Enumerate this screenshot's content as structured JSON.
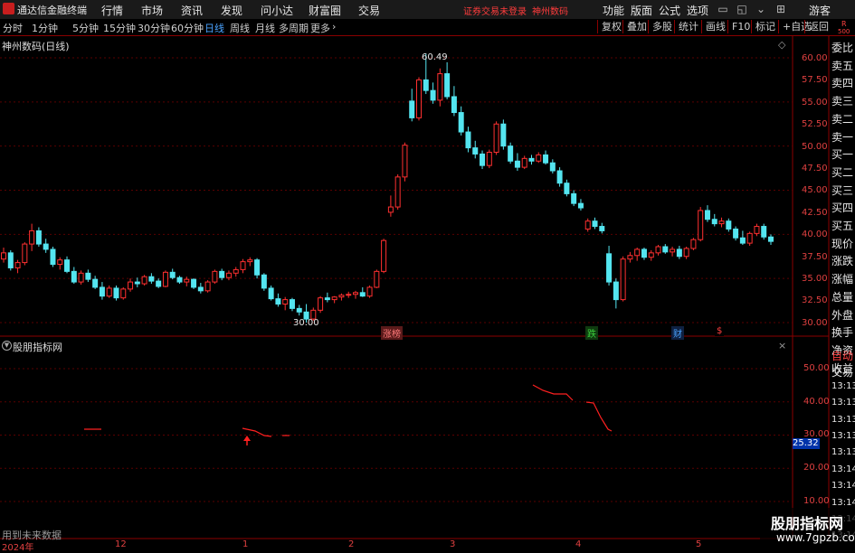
{
  "app": {
    "title": "通达信金融终端",
    "menu": [
      "行情",
      "市场",
      "资讯",
      "发现",
      "问小达",
      "财富圈",
      "交易"
    ],
    "login_warning": "证券交易未登录",
    "stock_label": "神州数码",
    "right_menu": [
      "功能",
      "版面",
      "公式",
      "选项"
    ],
    "user": "游客"
  },
  "period_bar": {
    "periods": [
      "分时",
      "1分钟",
      "5分钟",
      "15分钟",
      "30分钟",
      "60分钟",
      "日线",
      "周线",
      "月线",
      "多周期",
      "更多"
    ],
    "active": "日线",
    "tools": [
      "复权",
      "叠加",
      "多股",
      "统计",
      "画线",
      "F10",
      "标记",
      "+自选",
      "返回"
    ]
  },
  "main_chart": {
    "title": "神州数码(日线)",
    "y_ticks": [
      "60.00",
      "57.50",
      "55.00",
      "52.50",
      "50.00",
      "47.50",
      "45.00",
      "42.50",
      "40.00",
      "37.50",
      "35.00",
      "32.50",
      "30.00"
    ],
    "high_label": "60.49",
    "low_label": "30.00",
    "events": [
      {
        "text": "涨榜",
        "color": "#ff7a7a",
        "bg": "#5a1a1a"
      },
      {
        "text": "跌",
        "color": "#3ccf3c",
        "bg": "#0f3a0f"
      },
      {
        "text": "财",
        "color": "#4aa3ff",
        "bg": "#0f2040"
      },
      {
        "text": "$",
        "color": "#ff4040",
        "bg": "#000000"
      }
    ]
  },
  "indicator": {
    "title": "股朋指标网",
    "y_ticks": [
      "50.00",
      "40.00",
      "30.00",
      "20.00",
      "10.00"
    ],
    "current_value": "25.32",
    "no_data_text": "用到未来数据"
  },
  "x_axis": {
    "labels": [
      "2024年",
      "12",
      "1",
      "2",
      "3",
      "4",
      "5"
    ]
  },
  "right_panel": {
    "rows": [
      "委比",
      "卖五",
      "卖四",
      "卖三",
      "卖二",
      "卖一",
      "买一",
      "买二",
      "买三",
      "买四",
      "买五",
      "现价",
      "涨跌",
      "涨幅",
      "总量",
      "外盘",
      "换手",
      "净资",
      "收益"
    ],
    "bottom_rows": [
      "自动",
      "交易",
      "13:13",
      "13:13",
      "13:13",
      "13:13",
      "13:13",
      "13:14",
      "13:14",
      "13:14",
      "13:14",
      "13:14"
    ],
    "r_label": "R",
    "r_sub": "500"
  },
  "watermark": {
    "title": "股朋指标网",
    "url": "www.7gpzb.com"
  },
  "colors": {
    "up": "#ff3030",
    "down": "#54e5f0",
    "line": "#ff2020",
    "grid": "#8b0000"
  },
  "chart_data": {
    "type": "candlestick",
    "ylim": [
      29.0,
      61.0
    ],
    "high": 60.49,
    "low": 30.0,
    "candles": [
      [
        37.2,
        38.5,
        36.8,
        37.9
      ],
      [
        37.9,
        38.2,
        35.9,
        36.2
      ],
      [
        36.2,
        37.1,
        35.6,
        36.8
      ],
      [
        36.8,
        39.1,
        36.5,
        38.9
      ],
      [
        38.9,
        41.2,
        38.1,
        40.4
      ],
      [
        40.4,
        40.8,
        38.6,
        38.9
      ],
      [
        38.9,
        39.5,
        37.9,
        38.3
      ],
      [
        38.3,
        38.6,
        36.3,
        36.6
      ],
      [
        36.6,
        37.4,
        36.0,
        37.1
      ],
      [
        37.1,
        37.5,
        35.6,
        35.8
      ],
      [
        35.8,
        36.3,
        34.4,
        34.6
      ],
      [
        34.6,
        35.9,
        34.3,
        35.6
      ],
      [
        35.6,
        36.0,
        34.6,
        34.9
      ],
      [
        34.9,
        35.3,
        33.8,
        34.0
      ],
      [
        34.0,
        34.6,
        32.6,
        33.0
      ],
      [
        33.0,
        34.2,
        32.8,
        33.9
      ],
      [
        33.9,
        34.2,
        32.5,
        32.8
      ],
      [
        32.8,
        34.0,
        32.6,
        33.8
      ],
      [
        33.8,
        35.0,
        33.5,
        34.6
      ],
      [
        34.6,
        35.1,
        34.0,
        34.4
      ],
      [
        34.4,
        35.4,
        34.2,
        35.2
      ],
      [
        35.2,
        35.6,
        34.4,
        34.7
      ],
      [
        34.7,
        35.0,
        33.9,
        34.1
      ],
      [
        34.1,
        35.9,
        34.0,
        35.7
      ],
      [
        35.7,
        36.1,
        34.9,
        35.1
      ],
      [
        35.1,
        35.3,
        34.4,
        34.6
      ],
      [
        34.6,
        35.2,
        34.1,
        34.9
      ],
      [
        34.9,
        35.0,
        33.8,
        34.0
      ],
      [
        34.0,
        34.5,
        33.3,
        33.6
      ],
      [
        33.6,
        34.8,
        33.4,
        34.6
      ],
      [
        34.6,
        36.0,
        34.4,
        35.8
      ],
      [
        35.8,
        36.1,
        34.8,
        35.1
      ],
      [
        35.1,
        35.9,
        34.8,
        35.6
      ],
      [
        35.6,
        36.3,
        35.2,
        36.0
      ],
      [
        36.0,
        37.2,
        35.6,
        36.9
      ],
      [
        36.9,
        37.4,
        36.4,
        37.1
      ],
      [
        37.1,
        37.3,
        35.0,
        35.4
      ],
      [
        35.4,
        35.6,
        33.6,
        33.9
      ],
      [
        33.9,
        34.2,
        32.5,
        32.7
      ],
      [
        32.7,
        33.3,
        31.8,
        32.1
      ],
      [
        32.1,
        32.9,
        31.4,
        32.6
      ],
      [
        32.6,
        32.8,
        31.3,
        31.6
      ],
      [
        31.6,
        32.0,
        30.8,
        31.2
      ],
      [
        31.2,
        32.1,
        30.0,
        30.4
      ],
      [
        30.4,
        31.7,
        30.2,
        31.4
      ],
      [
        31.4,
        33.0,
        31.1,
        32.8
      ],
      [
        32.8,
        33.4,
        32.3,
        32.6
      ],
      [
        32.6,
        33.0,
        32.2,
        32.9
      ],
      [
        32.9,
        33.3,
        32.5,
        33.1
      ],
      [
        33.1,
        33.5,
        32.8,
        33.2
      ],
      [
        33.2,
        33.6,
        32.7,
        33.4
      ],
      [
        33.4,
        34.0,
        32.9,
        33.0
      ],
      [
        33.0,
        34.2,
        32.8,
        34.0
      ],
      [
        34.0,
        36.0,
        33.9,
        35.8
      ],
      [
        35.8,
        39.5,
        35.6,
        39.3
      ],
      [
        42.5,
        44.4,
        42.0,
        43.1
      ],
      [
        43.1,
        46.8,
        42.8,
        46.5
      ],
      [
        46.5,
        50.4,
        46.0,
        50.1
      ],
      [
        55.1,
        56.5,
        52.8,
        53.2
      ],
      [
        53.2,
        57.8,
        52.9,
        57.5
      ],
      [
        57.5,
        60.49,
        55.9,
        56.3
      ],
      [
        56.3,
        57.2,
        54.8,
        55.2
      ],
      [
        55.2,
        58.8,
        54.5,
        58.2
      ],
      [
        58.2,
        59.5,
        55.3,
        55.6
      ],
      [
        55.6,
        56.8,
        53.4,
        53.8
      ],
      [
        53.8,
        54.5,
        51.2,
        51.6
      ],
      [
        51.6,
        52.2,
        49.3,
        49.8
      ],
      [
        49.8,
        50.6,
        48.6,
        49.1
      ],
      [
        49.1,
        49.5,
        47.4,
        47.8
      ],
      [
        47.8,
        49.6,
        47.5,
        49.3
      ],
      [
        49.3,
        52.8,
        49.0,
        52.5
      ],
      [
        52.5,
        53.0,
        49.6,
        50.0
      ],
      [
        50.0,
        50.4,
        48.0,
        48.3
      ],
      [
        48.3,
        49.2,
        47.2,
        47.6
      ],
      [
        47.6,
        48.9,
        47.4,
        48.6
      ],
      [
        48.6,
        49.0,
        47.9,
        48.3
      ],
      [
        48.3,
        49.3,
        48.1,
        49.0
      ],
      [
        49.0,
        49.5,
        47.9,
        48.1
      ],
      [
        48.1,
        48.5,
        46.9,
        47.2
      ],
      [
        47.2,
        47.6,
        45.4,
        45.8
      ],
      [
        45.8,
        46.2,
        44.3,
        44.6
      ],
      [
        44.6,
        45.0,
        43.2,
        43.5
      ],
      [
        43.5,
        44.0,
        42.7,
        43.0
      ],
      [
        40.6,
        41.8,
        40.3,
        41.5
      ],
      [
        41.5,
        41.9,
        40.6,
        40.9
      ],
      [
        40.9,
        41.3,
        40.1,
        40.4
      ],
      [
        37.8,
        38.7,
        34.2,
        34.6
      ],
      [
        34.6,
        35.0,
        31.6,
        32.6
      ],
      [
        32.6,
        37.5,
        32.4,
        37.2
      ],
      [
        37.2,
        38.0,
        36.8,
        37.6
      ],
      [
        37.6,
        38.5,
        37.0,
        38.3
      ],
      [
        38.3,
        38.5,
        37.1,
        37.4
      ],
      [
        37.4,
        38.2,
        37.0,
        37.9
      ],
      [
        37.9,
        38.8,
        37.6,
        38.6
      ],
      [
        38.6,
        38.9,
        37.8,
        38.0
      ],
      [
        38.0,
        38.6,
        37.5,
        38.3
      ],
      [
        38.3,
        38.7,
        37.2,
        37.5
      ],
      [
        37.5,
        38.6,
        37.2,
        38.4
      ],
      [
        38.4,
        39.6,
        38.2,
        39.4
      ],
      [
        39.4,
        43.1,
        39.2,
        42.7
      ],
      [
        42.7,
        43.3,
        41.4,
        41.7
      ],
      [
        41.7,
        42.3,
        40.9,
        41.2
      ],
      [
        41.2,
        41.9,
        40.8,
        41.5
      ],
      [
        41.5,
        41.8,
        40.3,
        40.6
      ],
      [
        40.6,
        40.9,
        39.3,
        39.6
      ],
      [
        39.6,
        40.4,
        38.8,
        39.0
      ],
      [
        39.0,
        40.3,
        38.7,
        40.1
      ],
      [
        40.1,
        41.2,
        39.8,
        40.9
      ],
      [
        40.9,
        41.2,
        39.4,
        39.7
      ],
      [
        39.7,
        40.0,
        38.8,
        39.2
      ]
    ]
  }
}
